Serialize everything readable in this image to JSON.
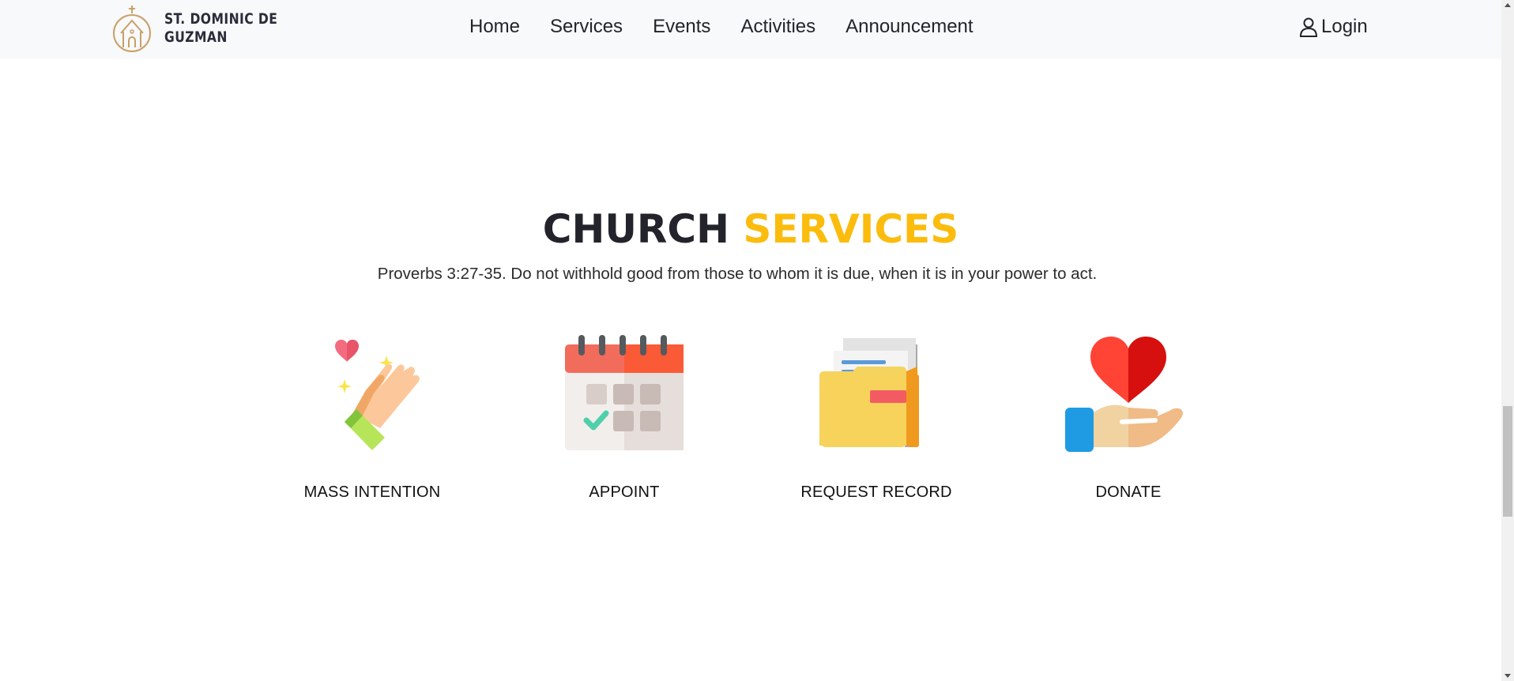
{
  "brand": {
    "line1": "ST. DOMINIC DE",
    "line2": "GUZMAN",
    "logo_icon": "church-logo-icon"
  },
  "nav": {
    "links": [
      "Home",
      "Services",
      "Events",
      "Activities",
      "Announcement"
    ],
    "login_label": "Login",
    "login_icon": "user-icon"
  },
  "section": {
    "title_part1": "CHURCH",
    "title_part2": "SERVICES",
    "verse": "Proverbs 3:27-35. Do not withhold good from those to whom it is due, when it is in your power to act."
  },
  "services": [
    {
      "label": "MASS INTENTION",
      "icon": "praying-hands-icon"
    },
    {
      "label": "APPOINT",
      "icon": "calendar-icon"
    },
    {
      "label": "REQUEST RECORD",
      "icon": "folder-documents-icon"
    },
    {
      "label": "DONATE",
      "icon": "heart-in-hand-icon"
    }
  ],
  "colors": {
    "accent": "#fbbc0e",
    "title_dark": "#23232b",
    "nav_bg": "#f8f9fa",
    "logo": "#c8a067"
  }
}
